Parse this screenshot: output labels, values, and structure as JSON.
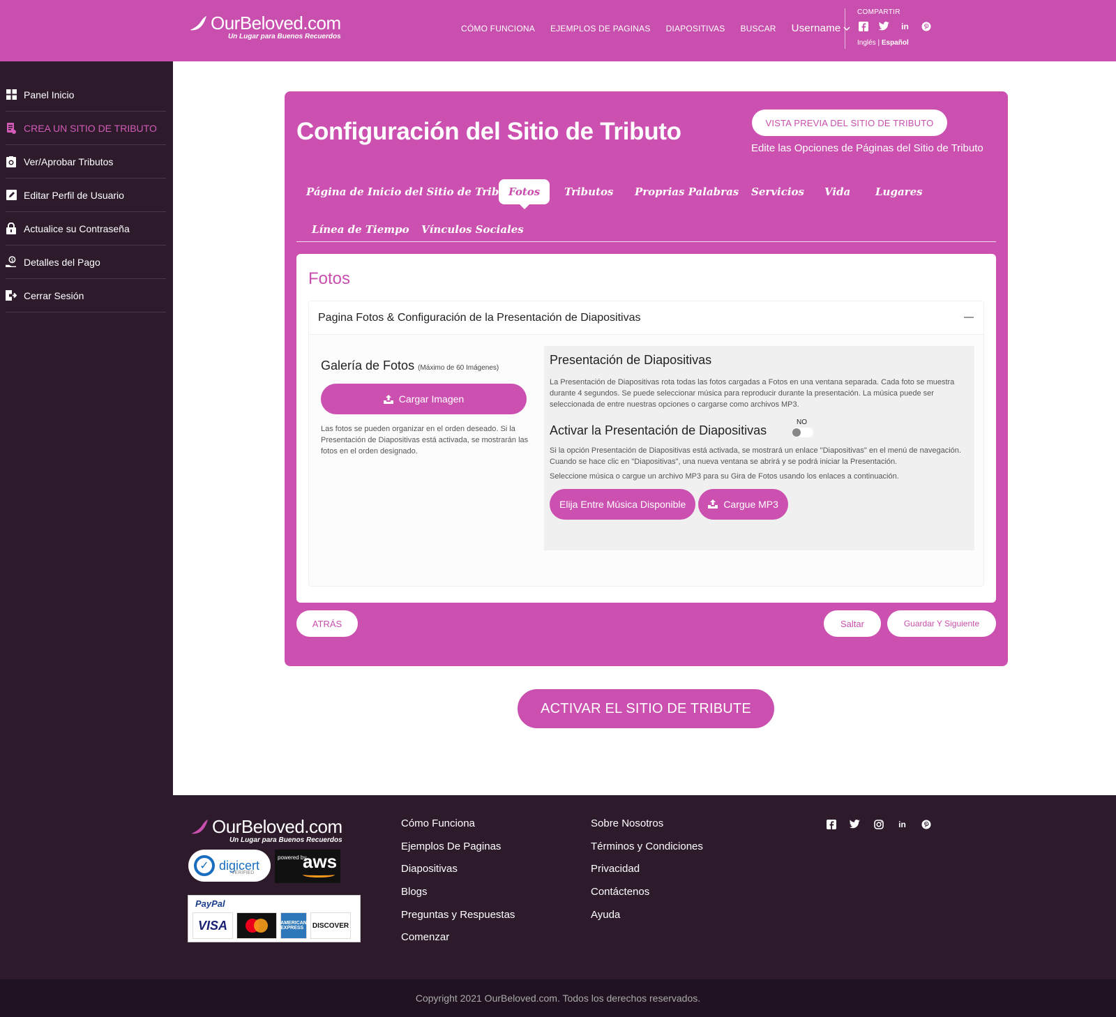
{
  "header": {
    "logo_name": "OurBeloved.com",
    "logo_tagline": "Un Lugar para Buenos Recuerdos",
    "nav": [
      "CÓMO FUNCIONA",
      "EJEMPLOS DE PAGINAS",
      "DIAPOSITIVAS",
      "BUSCAR"
    ],
    "username": "Username",
    "share_title": "COMPARTIR",
    "share_icons": [
      "facebook-icon",
      "twitter-icon",
      "linkedin-icon",
      "pinterest-icon"
    ],
    "lang_ingles": "Inglés",
    "lang_sep": " | ",
    "lang_espanol": "Español"
  },
  "sidebar": {
    "items": [
      {
        "label": "Panel Inicio",
        "icon": "dashboard-icon"
      },
      {
        "label": "CREA UN SITIO DE TRIBUTO",
        "icon": "build-icon",
        "active": true
      },
      {
        "label": "Ver/Aprobar Tributos",
        "icon": "approve-icon"
      },
      {
        "label": "Editar Perfil de Usuario",
        "icon": "edit-icon"
      },
      {
        "label": "Actualice su Contraseña",
        "icon": "lock-icon"
      },
      {
        "label": "Detalles del Pago",
        "icon": "payment-icon"
      },
      {
        "label": "Cerrar Sesión",
        "icon": "logout-icon"
      }
    ]
  },
  "card": {
    "title": "Configuración del Sitio de Tributo",
    "preview_button": "VISTA PREVIA DEL SITIO DE TRIBUTO",
    "edit_note": "Edite las Opciones de Páginas del Sitio de Tributo",
    "tabs": [
      "Página de Inicio del Sitio de Tributo",
      "Fotos",
      "Tributos",
      "Proprias Palabras",
      "Servicios",
      "Vida",
      "Lugares",
      "Línea de Tiempo",
      "Vínculos Sociales"
    ],
    "active_tab": "Fotos"
  },
  "panel": {
    "title": "Fotos",
    "accordion_title": "Pagina Fotos & Configuración de la Presentación de Diapositivas",
    "gallery": {
      "title": "Galería de Fotos",
      "max_note": "(Máximo de 60 Imágenes)",
      "upload_button": "Cargar Imagen",
      "note": "Las fotos se pueden organizar en el orden deseado. Si la Presentación de Diapositivas está activada, se mostrarán las fotos en el orden designado."
    },
    "slideshow": {
      "title": "Presentación de Diapositivas",
      "description": "La Presentación de Diapositivas rota todas las fotos cargadas a Fotos en una ventana separada. Cada foto se muestra durante 4 segundos. Se puede seleccionar música para reproducir durante la presentación. La música puede ser seleccionada de entre nuestras opciones o cargarse como archivos MP3.",
      "activate_label": "Activar la Presentación de Diapositivas",
      "toggle_state": "NO",
      "activate_note": "Si la opción Presentación de Diapositivas está activada, se mostrará un enlace \"Diapositivas\" en el menú de navegación. Cuando se hace clic en \"Diapositivas\", una nueva ventana se abrirá y se podrá iniciar la Presentación.",
      "music_note": "Seleccione música o cargue un archivo MP3 para su Gira de Fotos usando los enlaces a continuación.",
      "choose_music_button": "Elija Entre Música Disponible",
      "upload_mp3_button": "Cargue MP3"
    }
  },
  "actions": {
    "back": "ATRÁS",
    "skip": "Saltar",
    "save_next": "Guardar Y Siguiente",
    "activate_site": "ACTIVAR EL SITIO DE TRIBUTE"
  },
  "footer": {
    "logo_name": "OurBeloved.com",
    "logo_tagline": "Un Lugar para Buenos Recuerdos",
    "digicert": "digicert",
    "digicert_sub": "VERIFIED",
    "aws_powered": "powered by",
    "aws": "aws",
    "paypal": "PayPal",
    "visa": "VISA",
    "mastercard": "mastercard",
    "amex": "AMERICAN EXPRESS",
    "discover": "DISCOVER",
    "col1": [
      "Cómo Funciona",
      "Ejemplos De Paginas",
      "Diapositivas",
      "Blogs",
      "Preguntas y Respuestas",
      "Comenzar"
    ],
    "col2": [
      "Sobre Nosotros",
      "Términos y Condiciones",
      "Privacidad",
      "Contáctenos",
      "Ayuda"
    ],
    "social_icons": [
      "facebook-icon",
      "twitter-icon",
      "instagram-icon",
      "linkedin-icon",
      "pinterest-icon"
    ],
    "copyright": "Copyright 2021 OurBeloved.com. Todos los derechos reservados."
  },
  "colors": {
    "brand_pink": "#c94fae",
    "sidebar_bg": "#2d1b2c",
    "footer_bg": "#2d1b2c"
  }
}
